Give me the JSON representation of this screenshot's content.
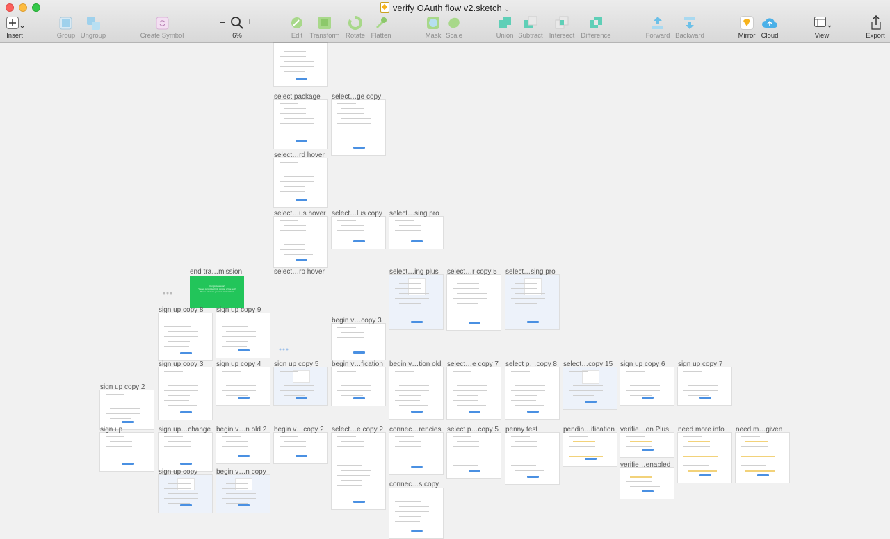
{
  "window": {
    "title": "verify OAuth flow v2.sketch"
  },
  "toolbar": {
    "insert": "Insert",
    "group": "Group",
    "ungroup": "Ungroup",
    "create_symbol": "Create Symbol",
    "zoom_minus": "–",
    "zoom_plus": "+",
    "zoom_level": "6%",
    "edit": "Edit",
    "transform": "Transform",
    "rotate": "Rotate",
    "flatten": "Flatten",
    "mask": "Mask",
    "scale": "Scale",
    "union": "Union",
    "subtract": "Subtract",
    "intersect": "Intersect",
    "difference": "Difference",
    "forward": "Forward",
    "backward": "Backward",
    "mirror": "Mirror",
    "cloud": "Cloud",
    "view": "View",
    "export": "Export"
  },
  "colors": {
    "accent_blue": "#4a90e2",
    "success_green": "#22c55a",
    "toolbar_bg": "#dcdcdc"
  },
  "end_transmission": {
    "line1": "Congratulations!",
    "line2": "You've completed this portion of the test!",
    "line3": "Please return to your test instructions."
  },
  "artboards": [
    {
      "label": "select package"
    },
    {
      "label": "select…ge copy"
    },
    {
      "label": "select…rd hover"
    },
    {
      "label": "select…us hover"
    },
    {
      "label": "select…lus copy"
    },
    {
      "label": "select…sing pro"
    },
    {
      "label": "end tra…mission"
    },
    {
      "label": "select…ro hover"
    },
    {
      "label": "select…ing plus"
    },
    {
      "label": "select…r copy 5"
    },
    {
      "label": "select…sing pro"
    },
    {
      "label": "sign up copy 8"
    },
    {
      "label": "sign up copy 9"
    },
    {
      "label": "begin v…copy 3"
    },
    {
      "label": "sign up copy 3"
    },
    {
      "label": "sign up copy 4"
    },
    {
      "label": "sign up copy 5"
    },
    {
      "label": "begin v…fication"
    },
    {
      "label": "begin v…tion old"
    },
    {
      "label": "select…e copy 7"
    },
    {
      "label": "select p…copy 8"
    },
    {
      "label": "select…copy 15"
    },
    {
      "label": "sign up copy 6"
    },
    {
      "label": "sign up copy 7"
    },
    {
      "label": "sign up copy 2"
    },
    {
      "label": "sign up"
    },
    {
      "label": "sign up…change"
    },
    {
      "label": "begin v…n old 2"
    },
    {
      "label": "begin v…copy 2"
    },
    {
      "label": "select…e copy 2"
    },
    {
      "label": "connec…rencies"
    },
    {
      "label": "select p…copy 5"
    },
    {
      "label": "penny test"
    },
    {
      "label": "pendin…ification"
    },
    {
      "label": "verifie…on Plus"
    },
    {
      "label": "need more info"
    },
    {
      "label": "need m…given"
    },
    {
      "label": "verifie…enabled"
    },
    {
      "label": "sign up copy"
    },
    {
      "label": "begin v…n copy"
    },
    {
      "label": "connec…s copy"
    }
  ]
}
